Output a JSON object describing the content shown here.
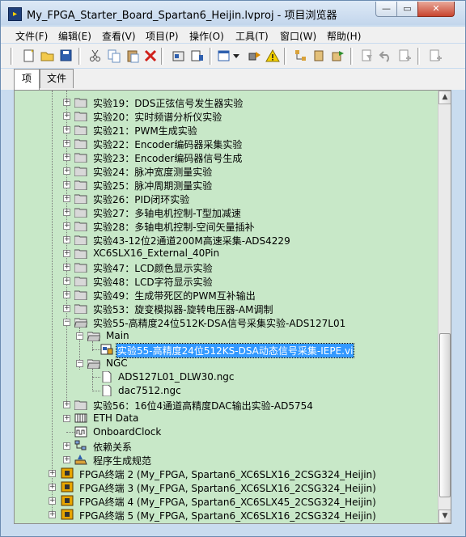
{
  "window": {
    "title": "My_FPGA_Starter_Board_Spartan6_Heijin.lvproj - 项目浏览器"
  },
  "menu": [
    {
      "label": "文件(F)"
    },
    {
      "label": "编辑(E)"
    },
    {
      "label": "查看(V)"
    },
    {
      "label": "项目(P)"
    },
    {
      "label": "操作(O)"
    },
    {
      "label": "工具(T)"
    },
    {
      "label": "窗口(W)"
    },
    {
      "label": "帮助(H)"
    }
  ],
  "tabs": [
    {
      "label": "项"
    },
    {
      "label": "文件"
    }
  ],
  "tree": {
    "experiments_top": [
      "实验19：DDS正弦信号发生器实验",
      "实验20：实时频谱分析仪实验",
      "实验21：PWM生成实验",
      "实验22：Encoder编码器采集实验",
      "实验23：Encoder编码器信号生成",
      "实验24：脉冲宽度测量实验",
      "实验25：脉冲周期测量实验",
      "实验26：PID闭环实验",
      "实验27：多轴电机控制-T型加减速",
      "实验28：多轴电机控制-空间矢量插补",
      "实验43-12位2通道200M高速采集-ADS4229",
      "XC6SLX16_External_40Pin",
      "实验47：LCD颜色显示实验",
      "实验48：LCD字符显示实验",
      "实验49：生成带死区的PWM互补输出",
      "实验53：旋变模拟器-旋转电压器-AM调制"
    ],
    "exp55": {
      "label": "实验55-高精度24位512K-DSA信号采集实验-ADS127L01",
      "main": {
        "label": "Main",
        "vi": "实验55-高精度24位512KS-DSA动态信号采集-IEPE.vi"
      },
      "ngc": {
        "label": "NGC",
        "files": [
          "ADS127L01_DLW30.ngc",
          "dac7512.ngc"
        ]
      }
    },
    "exp56": "实验56：16位4通道高精度DAC输出实验-AD5754",
    "eth": "ETH Data",
    "clock": "OnboardClock",
    "deps": "依赖关系",
    "build": "程序生成规范",
    "targets": [
      "FPGA终端 2 (My_FPGA, Spartan6_XC6SLX16_2CSG324_Heijin)",
      "FPGA终端 3 (My_FPGA, Spartan6_XC6SLX16_2CSG324_Heijin)",
      "FPGA终端 4 (My_FPGA, Spartan6_XC6SLX45_2CSG324_Heijin)",
      "FPGA终端 5 (My_FPGA, Spartan6_XC6SLX16_2CSG324_Heijin)"
    ]
  },
  "colors": {
    "tree_bg": "#c8e8c8",
    "selection": "#3399ff",
    "folder": "#d8d8d8"
  }
}
